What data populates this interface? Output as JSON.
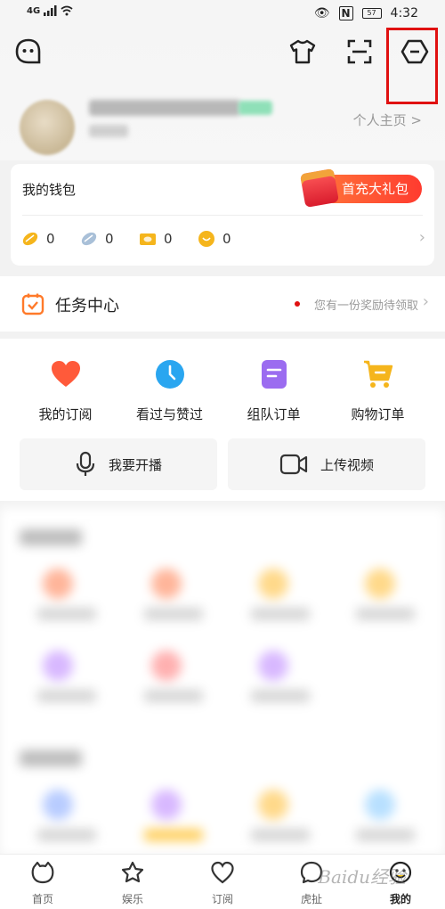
{
  "status_bar": {
    "network": "4G",
    "time": "4:32",
    "battery": "57"
  },
  "header": {
    "profile_link": "个人主页 >"
  },
  "wallet": {
    "title": "我的钱包",
    "gift_button": "首充大礼包",
    "assets": [
      {
        "icon": "gold-bean-icon",
        "value": "0",
        "color": "#f5b51c"
      },
      {
        "icon": "silver-bean-icon",
        "value": "0",
        "color": "#9fb6cf"
      },
      {
        "icon": "ticket-icon",
        "value": "0",
        "color": "#f5b51c"
      },
      {
        "icon": "coin-icon",
        "value": "0",
        "color": "#f5b51c"
      }
    ]
  },
  "task_center": {
    "title": "任务中心",
    "reward_text": "您有一份奖励待领取"
  },
  "shortcuts": [
    {
      "label": "我的订阅",
      "icon": "heart-icon",
      "color": "#ff5a3a"
    },
    {
      "label": "看过与赞过",
      "icon": "clock-icon",
      "color": "#2aa6f0"
    },
    {
      "label": "组队订单",
      "icon": "document-icon",
      "color": "#9b6cf0"
    },
    {
      "label": "购物订单",
      "icon": "cart-icon",
      "color": "#f5b51c"
    }
  ],
  "actions": [
    {
      "label": "我要开播",
      "icon": "microphone-icon"
    },
    {
      "label": "上传视频",
      "icon": "video-camera-icon"
    }
  ],
  "bottom_nav": [
    {
      "label": "首页",
      "icon": "home-icon",
      "active": false
    },
    {
      "label": "娱乐",
      "icon": "star-icon",
      "active": false
    },
    {
      "label": "订阅",
      "icon": "heart-outline-icon",
      "active": false
    },
    {
      "label": "虎扯",
      "icon": "chat-bubble-icon",
      "active": false
    },
    {
      "label": "我的",
      "icon": "profile-face-icon",
      "active": true
    }
  ],
  "watermark": "Baidu经验"
}
